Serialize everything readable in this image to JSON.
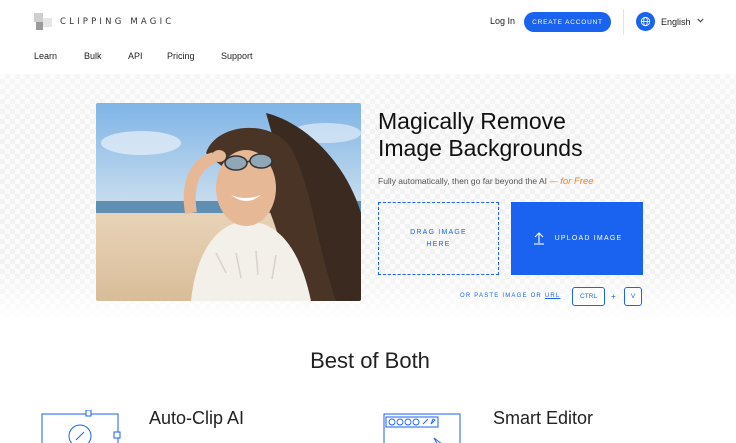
{
  "header": {
    "logo_text": "CLIPPING MAGIC",
    "login_label": "Log In",
    "create_account_label": "CREATE ACCOUNT",
    "language_label": "English"
  },
  "nav": {
    "items": [
      "Learn",
      "Bulk",
      "API",
      "Pricing",
      "Support"
    ]
  },
  "hero": {
    "title_line1": "Magically Remove",
    "title_line2": "Image Backgrounds",
    "subtitle": "Fully automatically, then go far beyond the AI",
    "subtitle_dash": "—",
    "subtitle_free": "for Free",
    "drag_line1": "DRAG IMAGE",
    "drag_line2": "HERE",
    "upload_label": "UPLOAD IMAGE",
    "paste_prefix": "OR PASTE IMAGE OR",
    "paste_url": "URL",
    "key_ctrl": "CTRL",
    "key_plus": "+",
    "key_v": "V"
  },
  "section": {
    "title": "Best of Both",
    "feature1_title": "Auto-Clip AI",
    "feature2_title": "Smart Editor"
  },
  "colors": {
    "accent": "#1a62f0",
    "free_orange": "#ff7a1a"
  },
  "icons": [
    "globe-chat-icon",
    "chevron-down-icon",
    "upload-arrow-icon",
    "auto-clip-illustration-icon",
    "smart-editor-illustration-icon"
  ]
}
